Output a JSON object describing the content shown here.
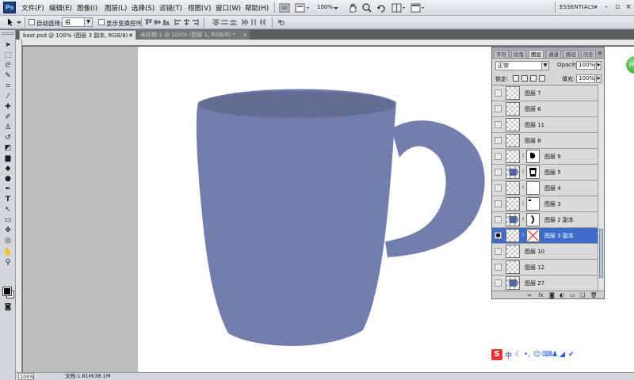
{
  "app": {
    "logo": "Ps",
    "workspace": "ESSENTIALS"
  },
  "menu": [
    {
      "label": "文件(F)"
    },
    {
      "label": "编辑(E)"
    },
    {
      "label": "图像(I)"
    },
    {
      "label": "图层(L)"
    },
    {
      "label": "选择(S)"
    },
    {
      "label": "滤镜(T)"
    },
    {
      "label": "视图(V)"
    },
    {
      "label": "窗口(W)"
    },
    {
      "label": "帮助(H)"
    }
  ],
  "menubar_tools": {
    "zoom": "100%"
  },
  "options": {
    "auto_select_label": "自动选择:",
    "auto_select_value": "组",
    "show_transform_label": "显示变换控件"
  },
  "tabs": [
    {
      "label": "bast.psd @ 100% (图层 3 副本, RGB/8) *",
      "close": "×"
    },
    {
      "label": "未标题-1 @ 100% (图层 1, RGB/8) *",
      "close": "×"
    }
  ],
  "status": {
    "zoom": "100%",
    "doc": "文档:1.81M/38.1M"
  },
  "layers_panel": {
    "tabs": [
      "字符",
      "段落",
      "图层",
      "通道",
      "路径",
      "历史"
    ],
    "active_tab": "图层",
    "blend_mode": "正常",
    "opacity_label": "Opacity:",
    "opacity_value": "100%",
    "lock_label": "锁定:",
    "fill_label": "填充:",
    "fill_value": "100%",
    "layers": [
      {
        "name": "图层 7",
        "mask": false,
        "thumb": "empty",
        "selected": false,
        "visible": false
      },
      {
        "name": "图层 6",
        "mask": false,
        "thumb": "empty",
        "selected": false,
        "visible": false
      },
      {
        "name": "图层 11",
        "mask": false,
        "thumb": "empty",
        "selected": false,
        "visible": false
      },
      {
        "name": "图层 8",
        "mask": false,
        "thumb": "empty",
        "selected": false,
        "visible": false
      },
      {
        "name": "图层 9",
        "mask": true,
        "thumb": "empty",
        "mask_style": "blob",
        "selected": false,
        "visible": false
      },
      {
        "name": "图层 5",
        "mask": true,
        "thumb": "mug",
        "mask_style": "dark-mug",
        "selected": false,
        "visible": false
      },
      {
        "name": "图层 4",
        "mask": true,
        "thumb": "empty",
        "mask_style": "white",
        "selected": false,
        "visible": false
      },
      {
        "name": "图层 3",
        "mask": true,
        "thumb": "empty",
        "mask_style": "edge",
        "selected": false,
        "visible": false
      },
      {
        "name": "图层 2 副本",
        "mask": true,
        "thumb": "mug",
        "mask_style": "curve",
        "selected": false,
        "visible": false
      },
      {
        "name": "图层 3 副本",
        "mask": true,
        "thumb": "empty",
        "mask_style": "cross",
        "selected": true,
        "visible": true
      },
      {
        "name": "图层 10",
        "mask": false,
        "thumb": "empty",
        "selected": false,
        "visible": false
      },
      {
        "name": "图层 12",
        "mask": false,
        "thumb": "empty",
        "selected": false,
        "visible": false
      },
      {
        "name": "图层 27",
        "mask": false,
        "thumb": "mug",
        "selected": false,
        "visible": false
      }
    ]
  },
  "ime": {
    "logo": "S",
    "lang": "中"
  },
  "side_badge": "39",
  "colors": {
    "mug": "#5564a0",
    "mug_dark": "#3a4680",
    "selection": "#3c6ec9"
  }
}
